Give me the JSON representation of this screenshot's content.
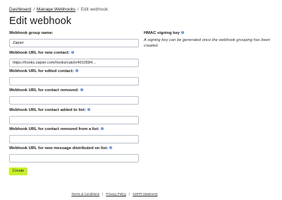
{
  "breadcrumb": {
    "items": [
      "Dashboard",
      "Manage Webhooks"
    ],
    "current": "Edit webhook",
    "separator": "/"
  },
  "page": {
    "title": "Edit webhook"
  },
  "form": {
    "group_name_label": "Webhook group name:",
    "group_name_value": "Zapier",
    "fields": [
      {
        "label": "Webhook URL for new contact:",
        "value": "https://hooks.zapier.com/hooks/catch/4910584…"
      },
      {
        "label": "Webhook URL for edited contact:",
        "value": ""
      },
      {
        "label": "Webhook URL for contact removed:",
        "value": ""
      },
      {
        "label": "Webhook URL for contact added to list:",
        "value": ""
      },
      {
        "label": "Webhook URL for contact removed from a list:",
        "value": ""
      },
      {
        "label": "Webhook URL for new message distributed on list:",
        "value": ""
      }
    ],
    "submit_label": "Create"
  },
  "hmac": {
    "title": "HMAC signing key",
    "description": "A signing key can be generated once the webhook grouping has been created."
  },
  "footer": {
    "links": [
      "Terms & Conditions",
      "Privacy Policy",
      "GDPR Statement"
    ],
    "separator": "|"
  },
  "colors": {
    "accent_button": "#c8ef29",
    "info_icon": "#5d8dd6",
    "input_border": "#b9c2cc"
  },
  "icons": {
    "info": "info-icon"
  }
}
